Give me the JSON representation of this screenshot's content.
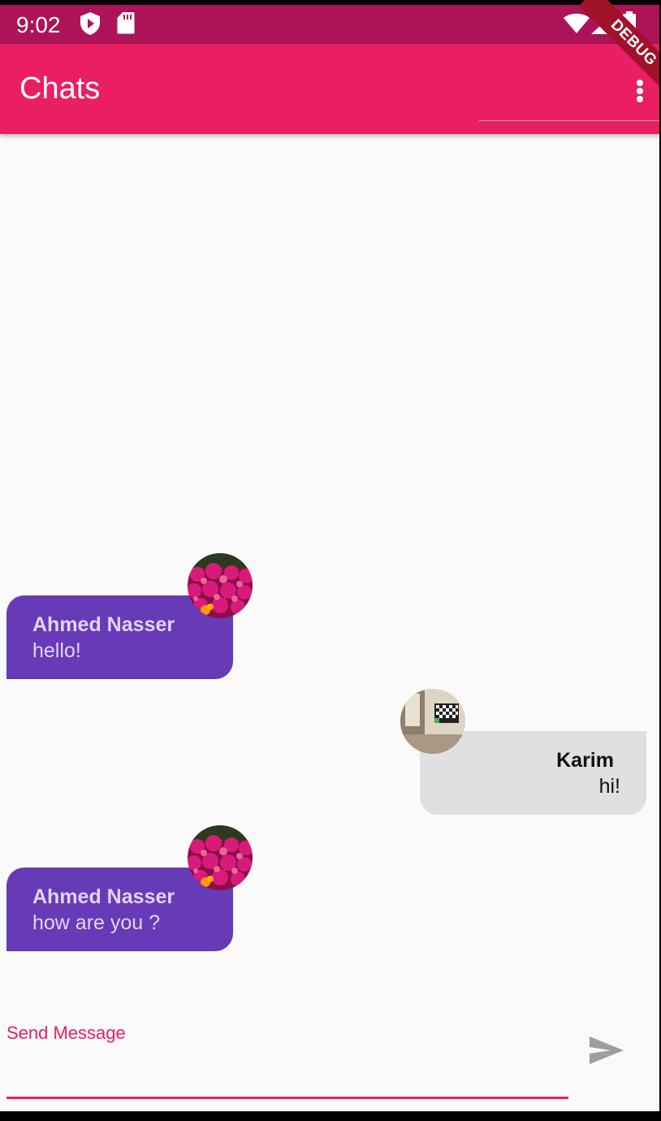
{
  "status_bar": {
    "time": "9:02",
    "left_icons": [
      "shield-play-icon",
      "sd-card-icon"
    ],
    "right_icons": [
      "wifi-icon",
      "signal-icon",
      "battery-icon"
    ],
    "debug_banner": "DEBUG"
  },
  "app_bar": {
    "title": "Chats",
    "menu_icon": "more-vert-icon"
  },
  "messages": [
    {
      "sender": "Ahmed Nasser",
      "text": "hello!",
      "side": "left",
      "avatar": "flowers-avatar"
    },
    {
      "sender": "Karim",
      "text": "hi!",
      "side": "right",
      "avatar": "room-avatar"
    },
    {
      "sender": "Ahmed Nasser",
      "text": "how are you ?",
      "side": "left",
      "avatar": "flowers-avatar"
    }
  ],
  "composer": {
    "label": "Send Message",
    "value": "",
    "send_icon": "send-icon"
  },
  "colors": {
    "status_bar": "#ad1457",
    "app_bar": "#e91e63",
    "incoming_bubble": "#673ab7",
    "outgoing_bubble": "#e0e0e0",
    "accent": "#e91e63"
  }
}
